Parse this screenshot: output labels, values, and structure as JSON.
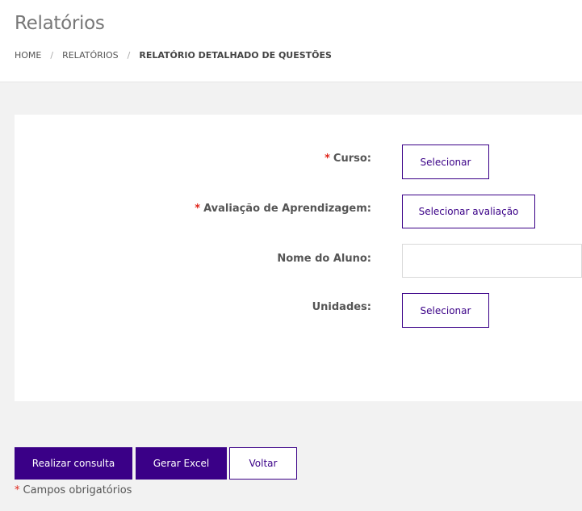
{
  "header": {
    "title": "Relatórios",
    "breadcrumb": {
      "home": "HOME",
      "separator": "/",
      "reports": "RELATÓRIOS",
      "current": "RELATÓRIO DETALHADO DE QUESTÕES"
    }
  },
  "form": {
    "required_mark": "*",
    "curso": {
      "label": "Curso:",
      "button": "Selecionar"
    },
    "avaliacao": {
      "label": "Avaliação de Aprendizagem:",
      "button": "Selecionar avaliação"
    },
    "nome_aluno": {
      "label": "Nome do Aluno:",
      "value": ""
    },
    "unidades": {
      "label": "Unidades:",
      "button": "Selecionar"
    }
  },
  "actions": {
    "consultar": "Realizar consulta",
    "excel": "Gerar Excel",
    "voltar": "Voltar"
  },
  "footnote": {
    "mark": "*",
    "text": "Campos obrigatórios"
  },
  "colors": {
    "primary": "#3a0087",
    "required": "#e0261b"
  }
}
